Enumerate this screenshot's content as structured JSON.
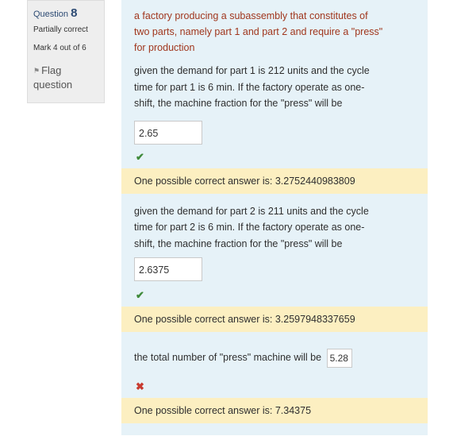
{
  "info": {
    "question_label": "Question",
    "question_number": "8",
    "state": "Partially correct",
    "grade": "Mark 4 out of 6",
    "flag_label_line1": "Flag",
    "flag_label_line2": "question"
  },
  "question": {
    "intro_line1": "a factory producing a subassembly that constitutes of",
    "intro_line2": "two parts, namely part 1 and part 2 and require a \"press\"",
    "intro_line3": "for production",
    "part1": {
      "line1": "given the demand for part 1 is 212 units and the cycle",
      "line2": "time for part 1 is 6 min. If the factory operate as one-",
      "line3": "shift, the machine fraction for the \"press\" will be",
      "answer": "2.65",
      "mark": "✔",
      "feedback": "One possible correct answer is: 3.2752440983809"
    },
    "part2": {
      "line1": "given the demand for part 2 is 211 units and the cycle",
      "line2": "time for part 2 is 6 min. If the factory operate as one-",
      "line3": "shift, the machine fraction for the \"press\" will be",
      "answer": "2.6375",
      "mark": "✔",
      "feedback": "One possible correct answer is: 3.2597948337659"
    },
    "part3": {
      "text": "the total number of \"press\" machine will be",
      "answer": "5.28",
      "mark": "✖",
      "feedback": "One possible correct answer is: 7.34375"
    }
  },
  "colors": {
    "intro_text": "#a0361d",
    "content_bg": "#e6f2f8",
    "feedback_bg": "#fcefc1",
    "correct": "#3f8a3a",
    "incorrect": "#c83b30"
  }
}
